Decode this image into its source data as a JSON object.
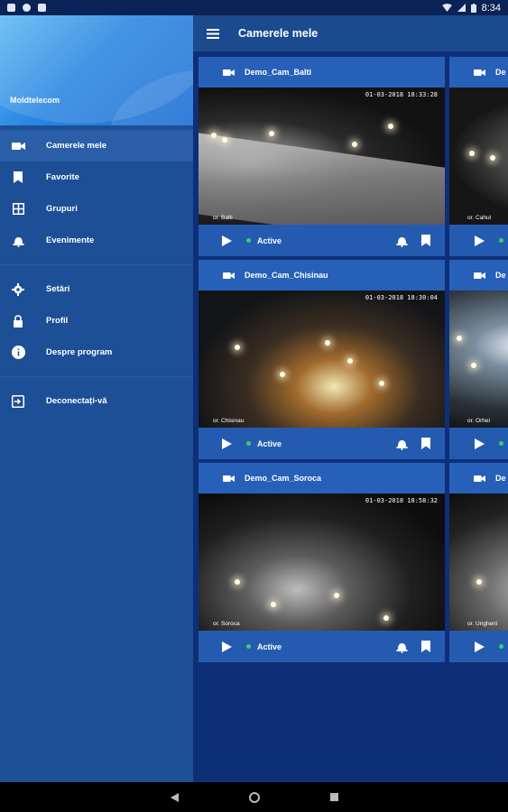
{
  "status_bar": {
    "time": "8:34"
  },
  "drawer": {
    "brand": "Moldtelecom",
    "items": [
      {
        "label": "Camerele mele",
        "icon": "videocam-icon",
        "active": true
      },
      {
        "label": "Favorite",
        "icon": "bookmark-icon",
        "active": false
      },
      {
        "label": "Grupuri",
        "icon": "grid-icon",
        "active": false
      },
      {
        "label": "Evenimente",
        "icon": "alarm-bell-icon",
        "active": false
      }
    ],
    "items2": [
      {
        "label": "Setări",
        "icon": "gear-icon"
      },
      {
        "label": "Profil",
        "icon": "lock-icon"
      },
      {
        "label": "Despre program",
        "icon": "info-icon"
      }
    ],
    "items3": [
      {
        "label": "Deconectați-vă",
        "icon": "logout-icon"
      }
    ]
  },
  "appbar": {
    "title": "Camerele mele"
  },
  "cameras": [
    {
      "name": "Demo_Cam_Balti",
      "timestamp": "01-03-2018 18:33:28",
      "place": "or. Balti",
      "status": "Active"
    },
    {
      "name": "Demo_Cam_Chisinau",
      "timestamp": "01-03-2018 18:30:04",
      "place": "or. Chisinau",
      "status": "Active"
    },
    {
      "name": "Demo_Cam_Soroca",
      "timestamp": "01-03-2018 18:58:32",
      "place": "or. Soroca",
      "status": "Active"
    }
  ],
  "cameras_right": [
    {
      "name_partial": "De",
      "place": "or. Cahul"
    },
    {
      "name_partial": "De",
      "place": "or. Orhei"
    },
    {
      "name_partial": "De",
      "place": "or. Ungheni"
    }
  ],
  "colors": {
    "drawer_bg": "#1d4f96",
    "content_bg": "#0e2f78",
    "card_bg": "#245bb0",
    "active_dot": "#33d26b"
  }
}
